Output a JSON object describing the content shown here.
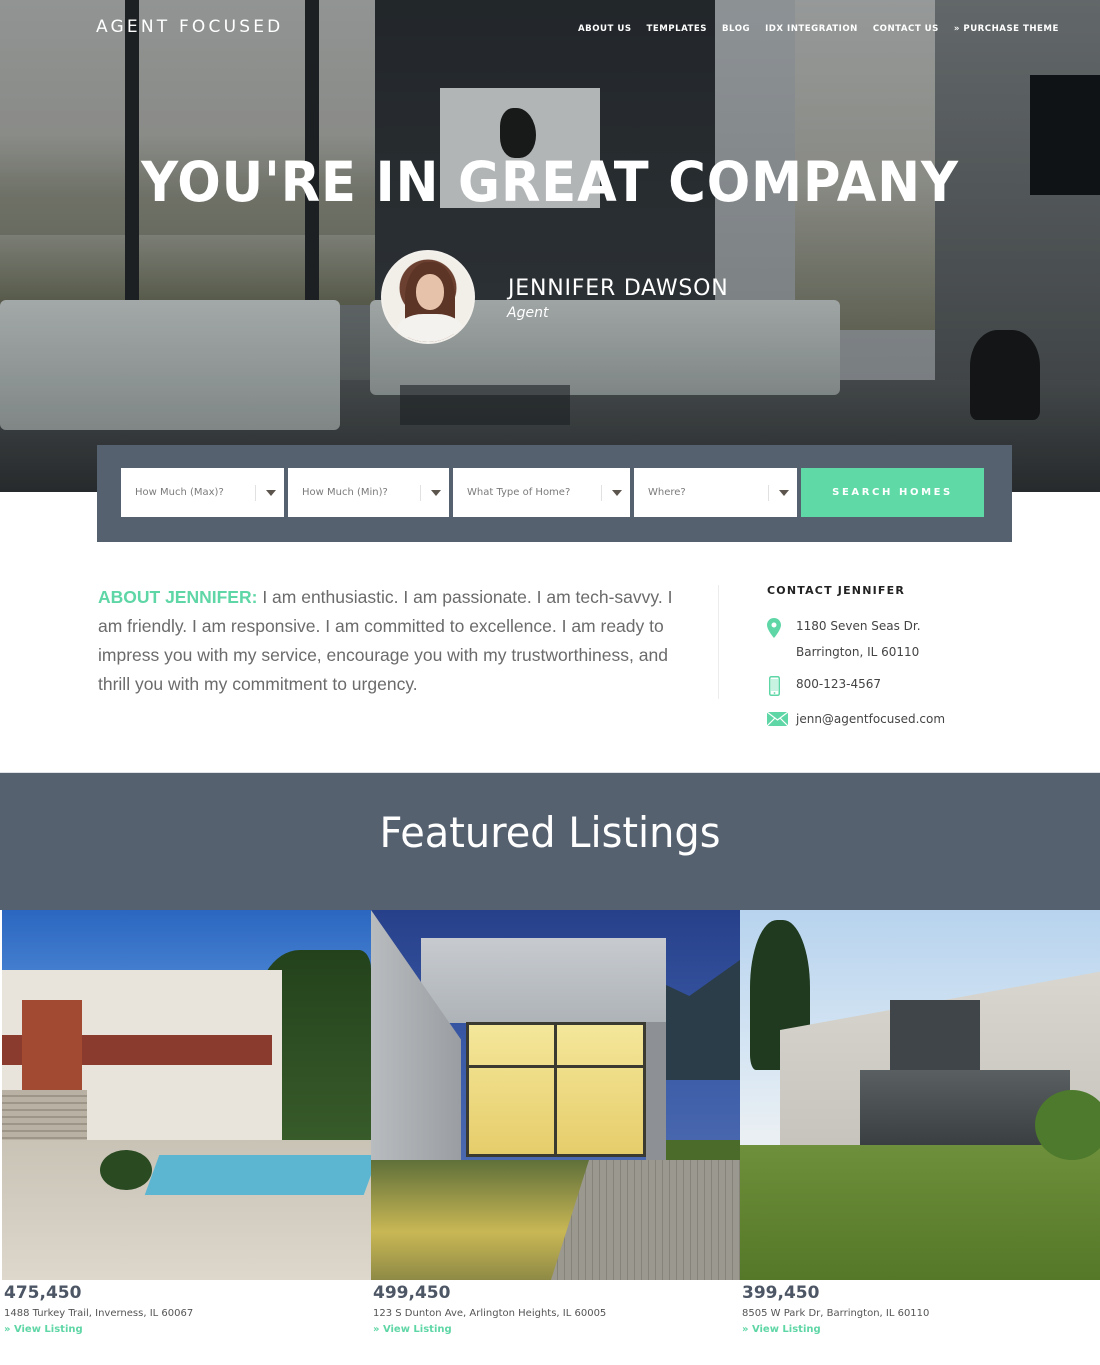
{
  "header": {
    "brand": "AGENT FOCUSED",
    "nav": [
      {
        "label": "ABOUT US"
      },
      {
        "label": "TEMPLATES"
      },
      {
        "label": "BLOG"
      },
      {
        "label": "IDX INTEGRATION"
      },
      {
        "label": "CONTACT US"
      },
      {
        "label": "» PURCHASE THEME"
      }
    ]
  },
  "hero": {
    "title": "YOU'RE IN GREAT COMPANY",
    "agent_name": "JENNIFER DAWSON",
    "agent_role": "Agent",
    "avatar_icon": "agent-photo"
  },
  "search": {
    "fields": [
      {
        "placeholder": "How Much (Max)?"
      },
      {
        "placeholder": "How Much (Min)?"
      },
      {
        "placeholder": "What Type of Home?"
      },
      {
        "placeholder": "Where?"
      }
    ],
    "button_label": "SEARCH HOMES"
  },
  "about": {
    "lead": "ABOUT JENNIFER:",
    "text": " I am enthusiastic. I am passionate. I am tech-savvy. I am friendly. I am responsive. I am committed to excellence. I am ready to impress you with my service, encourage you with my trustworthiness, and thrill you with my commitment to urgency."
  },
  "contact": {
    "title": "CONTACT JENNIFER",
    "address_line1": "1180 Seven Seas Dr.",
    "address_line2": "Barrington, IL 60110",
    "phone": "800-123-4567",
    "email": "jenn@agentfocused.com",
    "icons": {
      "address": "map-pin-icon",
      "phone": "mobile-phone-icon",
      "email": "envelope-icon"
    }
  },
  "featured": {
    "title": "Featured Listings",
    "listings": [
      {
        "price": "475,450",
        "address": "1488 Turkey Trail,  Inverness, IL 60067",
        "link": "» View Listing"
      },
      {
        "price": "499,450",
        "address": "123 S Dunton Ave,  Arlington Heights, IL 60005",
        "link": "» View Listing"
      },
      {
        "price": "399,450",
        "address": "8505 W Park Dr,  Barrington, IL 60110",
        "link": "» View Listing"
      }
    ]
  },
  "colors": {
    "accent": "#5fdaa7",
    "panel": "#566170",
    "text": "#6b6b6b"
  }
}
